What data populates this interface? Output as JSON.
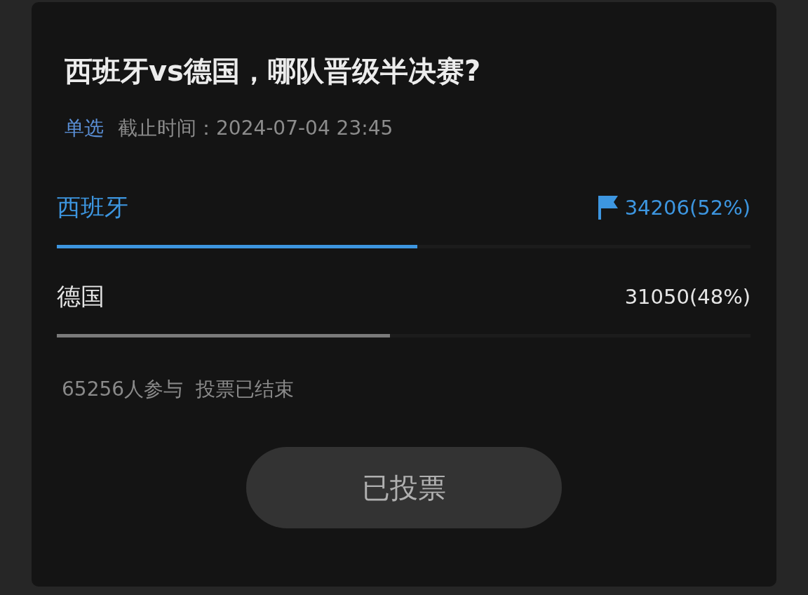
{
  "poll": {
    "title": "西班牙vs德国，哪队晋级半决赛?",
    "type_label": "单选",
    "deadline": "截止时间：2024-07-04 23:45",
    "options": [
      {
        "label": "西班牙",
        "count": "34206(52%)",
        "selected": true,
        "level": 0.52
      },
      {
        "label": "德国",
        "count": "31050(48%)",
        "selected": false,
        "level": 0.48
      }
    ],
    "participants": "65256人参与",
    "status": "投票已结束",
    "button": {
      "label": "已投票",
      "disabled": true
    }
  }
}
